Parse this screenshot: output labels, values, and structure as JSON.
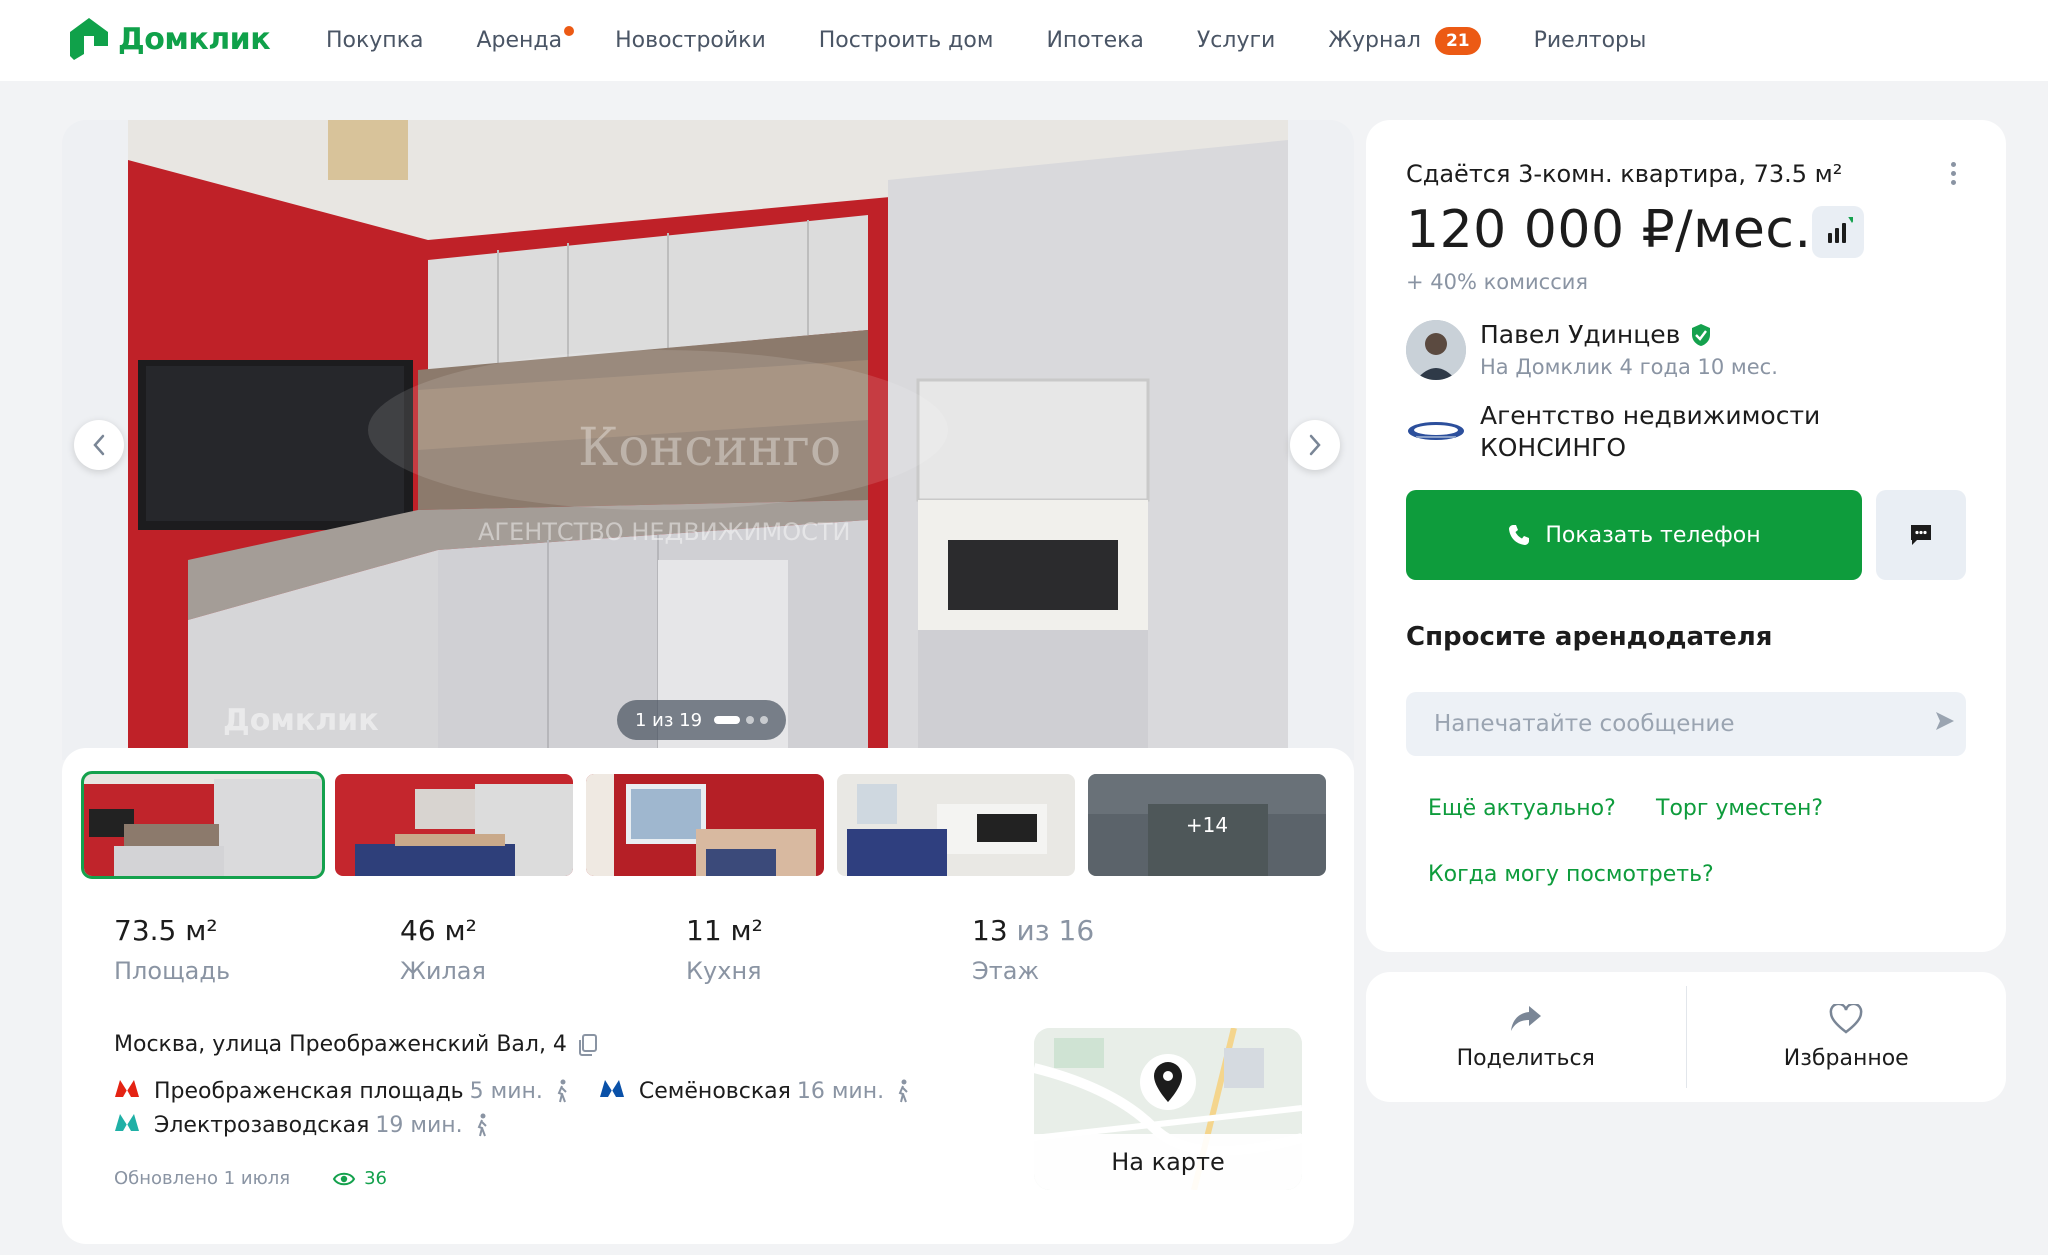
{
  "header": {
    "logo_text": "Домклик",
    "nav": [
      {
        "label": "Покупка"
      },
      {
        "label": "Аренда",
        "dot": true
      },
      {
        "label": "Новостройки"
      },
      {
        "label": "Построить дом"
      },
      {
        "label": "Ипотека"
      },
      {
        "label": "Услуги"
      },
      {
        "label": "Журнал",
        "badge": "21"
      },
      {
        "label": "Риелторы"
      }
    ]
  },
  "gallery": {
    "counter": "1 из 19",
    "watermark_brand": "Консинго",
    "watermark_sub": "АГЕНТСТВО НЕДВИЖИМОСТИ",
    "watermark_domclick": "Домклик",
    "more_label": "+14"
  },
  "stats": [
    {
      "value": "73.5 м²",
      "label": "Площадь"
    },
    {
      "value": "46 м²",
      "label": "Жилая"
    },
    {
      "value": "11 м²",
      "label": "Кухня"
    },
    {
      "value_main": "13",
      "value_muted": "из 16",
      "label": "Этаж"
    }
  ],
  "address": "Москва, улица Преображенский Вал, 4",
  "metro": [
    {
      "name": "Преображенская площадь",
      "time": "5 мин.",
      "color": "#e42313"
    },
    {
      "name": "Семёновская",
      "time": "16 мин.",
      "color": "#0a51a8"
    },
    {
      "name": "Электрозаводская",
      "time": "19 мин.",
      "color": "#1fb0a6"
    }
  ],
  "updated": "Обновлено 1 июля",
  "views": "36",
  "map_label": "На карте",
  "listing": {
    "title": "Сдаётся 3-комн. квартира, 73.5 м²",
    "price": "120 000 ₽/мес.",
    "commission": "+ 40% комиссия"
  },
  "agent": {
    "name": "Павел Удинцев",
    "tenure": "На Домклик 4 года 10 мес.",
    "agency_line1": "Агентство недвижимости",
    "agency_line2": "КОНСИНГО"
  },
  "buttons": {
    "show_phone": "Показать телефон"
  },
  "ask": {
    "title": "Спросите арендодателя",
    "placeholder": "Напечатайте сообщение",
    "chips": [
      "Ещё актуально?",
      "Торг уместен?",
      "Когда могу посмотреть?"
    ]
  },
  "actions": {
    "share": "Поделиться",
    "favorite": "Избранное"
  },
  "colors": {
    "brand_green": "#0e9c3c",
    "accent_orange": "#ec5a14",
    "muted_text": "#8a94a3"
  }
}
